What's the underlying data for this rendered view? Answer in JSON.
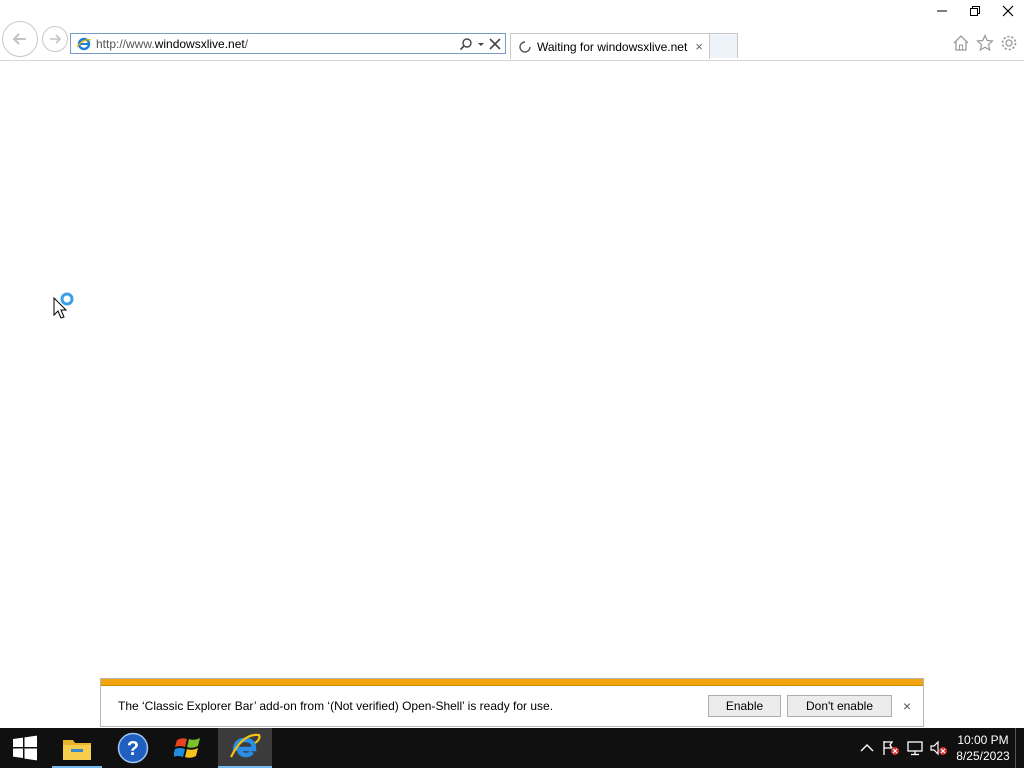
{
  "window": {
    "controls": [
      "minimize",
      "restore",
      "close"
    ]
  },
  "address_bar": {
    "url_prefix": "http://www.",
    "url_domain": "windowsxlive.net",
    "url_suffix": "/"
  },
  "tab": {
    "title": "Waiting for windowsxlive.net",
    "close_glyph": "×"
  },
  "toolbar_icons": [
    "home-icon",
    "favorites-star-icon",
    "settings-gear-icon"
  ],
  "notification": {
    "message": "The ‘Classic Explorer Bar’ add-on from ‘(Not verified) Open-Shell’ is ready for use.",
    "enable_label": "Enable",
    "dont_enable_label": "Don't enable",
    "close_glyph": "×",
    "accent_color": "#f0a30a"
  },
  "taskbar": {
    "pinned": [
      "start-button",
      "file-explorer",
      "help-and-support",
      "windows-logo-app",
      "internet-explorer"
    ],
    "active": "internet-explorer",
    "clock": {
      "time": "10:00 PM",
      "date": "8/25/2023"
    }
  }
}
